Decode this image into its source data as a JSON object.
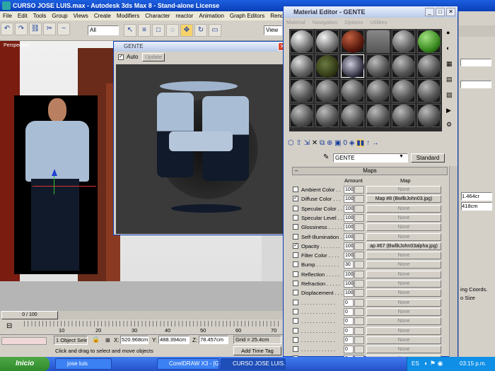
{
  "main_window": {
    "title": "CURSO JOSE LUIS.max - Autodesk 3ds Max 8  - Stand-alone License",
    "menu": [
      "File",
      "Edit",
      "Tools",
      "Group",
      "Views",
      "Create",
      "Modifiers",
      "Character",
      "reactor",
      "Animation",
      "Graph Editors",
      "Rendering"
    ],
    "selection_filter": "All",
    "view_label": "View",
    "viewport_label": "Perspective"
  },
  "timeline": {
    "frame_counter": "0 / 100",
    "ticks": [
      "10",
      "20",
      "30",
      "40",
      "50",
      "60",
      "70"
    ]
  },
  "status": {
    "selected": "1 Object Sele",
    "x_label": "X:",
    "x_value": "520.968cm",
    "y_label": "Y:",
    "y_value": "488.394cm",
    "z_label": "Z:",
    "z_value": "78.457cm",
    "grid": "Grid = 25.4cm",
    "prompt": "Click and drag to select and move objects",
    "add_time_tag": "Add Time Tag"
  },
  "gente_window": {
    "title": "GENTE",
    "auto_label": "Auto",
    "update_label": "Update"
  },
  "material_editor": {
    "title": "Material Editor - GENTE",
    "menu": [
      "Material",
      "Navigation",
      "Options",
      "Utilities"
    ],
    "material_name": "GENTE",
    "type_button": "Standard",
    "rollout_title": "Maps",
    "col_amount": "Amount",
    "col_map": "Map",
    "maps": [
      {
        "label": "Ambient Color . .",
        "amount": "100",
        "map": "None",
        "checked": false
      },
      {
        "label": "Diffuse Color . . .",
        "amount": "100",
        "map": "Map #8 (BwllkJohn03.jpg)",
        "checked": true
      },
      {
        "label": "Specular Color . .",
        "amount": "100",
        "map": "None",
        "checked": false
      },
      {
        "label": "Specular Level . .",
        "amount": "100",
        "map": "None",
        "checked": false
      },
      {
        "label": "Glossiness . . . . .",
        "amount": "100",
        "map": "None",
        "checked": false
      },
      {
        "label": "Self-Illumination . .",
        "amount": "100",
        "map": "None",
        "checked": false
      },
      {
        "label": "Opacity . . . . . . .",
        "amount": "100",
        "map": "ap #67 (BwllkJohn03alpha.jpg)",
        "checked": true
      },
      {
        "label": "Filter Color . . . .",
        "amount": "100",
        "map": "None",
        "checked": false
      },
      {
        "label": "Bump . . . . . . . .",
        "amount": "30",
        "map": "None",
        "checked": false
      },
      {
        "label": "Reflection . . . . .",
        "amount": "100",
        "map": "None",
        "checked": false
      },
      {
        "label": "Refraction . . . . .",
        "amount": "100",
        "map": "None",
        "checked": false
      },
      {
        "label": "Displacement . . .",
        "amount": "100",
        "map": "None",
        "checked": false
      },
      {
        "label": ". . . . . . . . . . . .",
        "amount": "0",
        "map": "None",
        "checked": false
      },
      {
        "label": ". . . . . . . . . . . .",
        "amount": "0",
        "map": "None",
        "checked": false
      },
      {
        "label": ". . . . . . . . . . . .",
        "amount": "0",
        "map": "None",
        "checked": false
      },
      {
        "label": ". . . . . . . . . . . .",
        "amount": "0",
        "map": "None",
        "checked": false
      },
      {
        "label": ". . . . . . . . . . . .",
        "amount": "0",
        "map": "None",
        "checked": false
      },
      {
        "label": ". . . . . . . . . . . .",
        "amount": "0",
        "map": "None",
        "checked": false
      },
      {
        "label": ". . . . . . . . . . . .",
        "amount": "0",
        "map": "None",
        "checked": false
      }
    ]
  },
  "right_panel": {
    "val1": "1.464cr",
    "val2": "418cm",
    "coords_label": "ing Coords.",
    "size_label": "o Size"
  },
  "taskbar": {
    "start": "Inicio",
    "items": [
      "jose luis",
      "CorelDRAW X3 - [Grá...",
      "CURSO JOSE LUIS.m..."
    ],
    "lang": "ES",
    "clock": "03:15 p.m."
  }
}
